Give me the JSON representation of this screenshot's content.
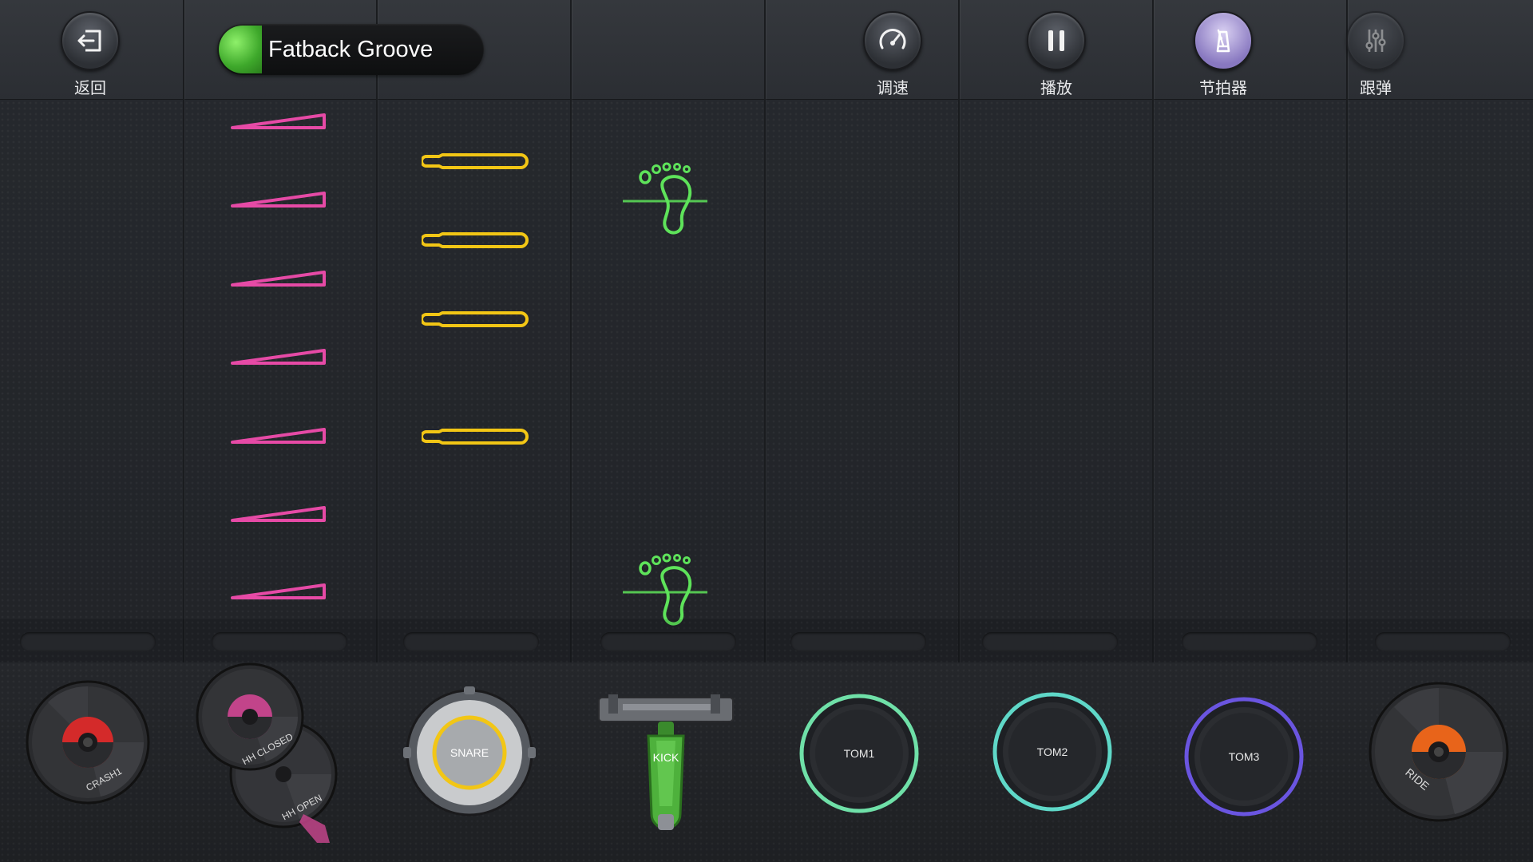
{
  "topbar": {
    "back_label": "返回",
    "groove_name": "Fatback Groove",
    "tempo_label": "调速",
    "play_label": "播放",
    "metronome_label": "节拍器",
    "follow_label": "跟弹"
  },
  "pads": {
    "crash": "CRASH1",
    "hh_closed": "HH CLOSED",
    "hh_open": "HH OPEN",
    "snare": "SNARE",
    "kick": "KICK",
    "tom1": "TOM1",
    "tom2": "TOM2",
    "tom3": "TOM3",
    "ride": "RIDE"
  },
  "colors": {
    "hihat_note": "#e64aa6",
    "snare_note": "#f2c615",
    "kick_note": "#5ee35a",
    "tom1_ring": "#6fe0a8",
    "tom2_ring": "#5fd8c8",
    "tom3_ring": "#6a55e0",
    "crash_accent": "#d42a2a",
    "hh_accent": "#c2448a",
    "ride_accent": "#e8641a",
    "groove_led": "#5fd33e"
  },
  "icons": {
    "back": "exit-icon",
    "tempo": "speedometer-icon",
    "play": "pause-icon",
    "metronome": "metronome-icon",
    "follow": "sliders-icon"
  }
}
